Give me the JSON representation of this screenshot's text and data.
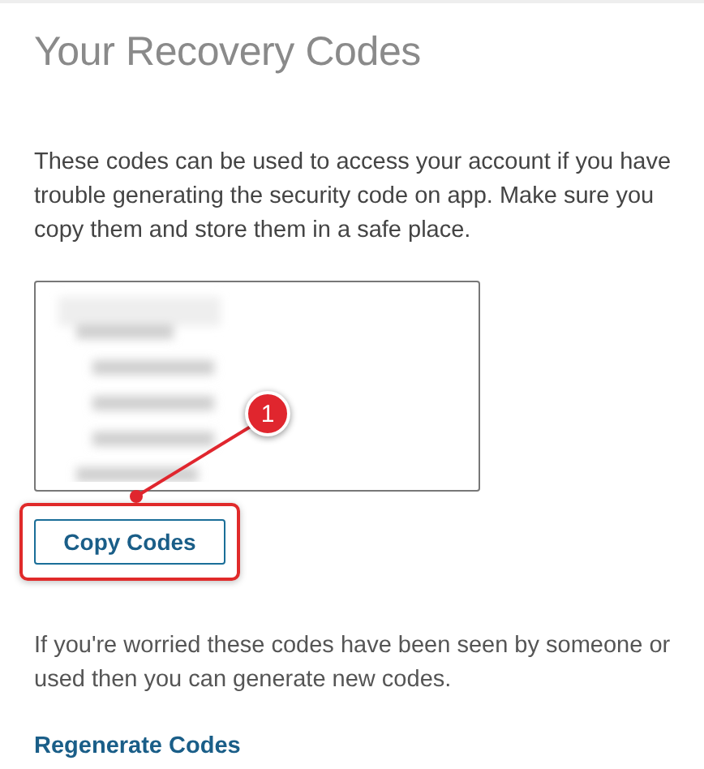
{
  "title": "Your Recovery Codes",
  "intro": "These codes can be used to access your account if you have trouble generating the security code on app. Make sure you copy them and store them in a safe place.",
  "copy_button": {
    "label": "Copy Codes",
    "highlighted": true
  },
  "annotation": {
    "number": "1"
  },
  "note": "If you're worried these codes have been seen by someone or used then you can generate new codes.",
  "regenerate_link": "Regenerate Codes"
}
